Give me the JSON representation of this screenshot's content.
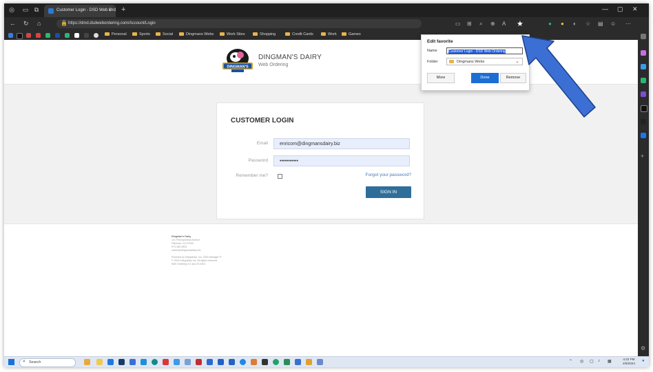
{
  "browser": {
    "tab_title": "Customer Login - DSD Web Ord",
    "url": "https://dmd.dsdwebordering.com/Account/Login",
    "bookmarks": [
      "Personal",
      "Sports",
      "Social",
      "Dingmans Webs",
      "Work Sites",
      "Shopping",
      "Credit Cards",
      "Work",
      "Games"
    ]
  },
  "header": {
    "brand": "DINGMAN'S DAIRY",
    "subtitle": "Web Ordering",
    "logo_text": "DINGMAN'S"
  },
  "login": {
    "title": "CUSTOMER LOGIN",
    "email_label": "Email",
    "email_value": "enricom@dingmansdairy.biz",
    "password_label": "Password",
    "password_value": "•••••••••••",
    "remember_label": "Remember me?",
    "forgot_link": "Forgot your password?",
    "signin_label": "SIGN IN"
  },
  "footer": {
    "company": "Dingman's Dairy",
    "address1": "101 Pennsylvania Avenue",
    "address2": "Paterson, NJ 07503",
    "phone": "973-380-0823",
    "email": "orders@dingmansdairy.biz",
    "powered": "Powered by IntegraSys, Inc. DSD Manager ®",
    "copyright": "© 2024 IntegraSys Inc. All rights reserved",
    "version": "Web Ordering 4.0 and 20.0002"
  },
  "favorite_popup": {
    "title": "Edit favorite",
    "name_label": "Name",
    "name_value": "Customer Login - DSD Web Ordering",
    "folder_label": "Folder",
    "folder_value": "Dingmans Webs",
    "more_label": "More",
    "done_label": "Done",
    "remove_label": "Remove"
  },
  "taskbar": {
    "search_label": "Search",
    "time": "4:22 PM",
    "date": "2/9/2024"
  },
  "colors": {
    "accent": "#2f6e9a",
    "link": "#4a77b4",
    "arrow": "#3b6fd4"
  }
}
